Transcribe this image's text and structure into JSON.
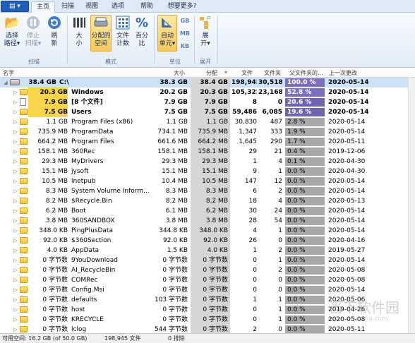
{
  "menu": {
    "app_button": "▤ ▾"
  },
  "tabs": [
    {
      "label": "主页",
      "active": true
    },
    {
      "label": "扫描",
      "active": false
    },
    {
      "label": "视图",
      "active": false
    },
    {
      "label": "选项",
      "active": false
    },
    {
      "label": "帮助",
      "active": false
    },
    {
      "label": "想要更多?",
      "active": false
    }
  ],
  "ribbon": {
    "choose_path": {
      "label1": "选择",
      "label2": "路径▾",
      "icon": "folder-open-icon"
    },
    "stop_scan": {
      "label1": "停止",
      "label2": "扫描▾",
      "icon": "pause-icon"
    },
    "refresh": {
      "label1": "刷",
      "label2": "新",
      "icon": "refresh-icon"
    },
    "group_scan": "扫描",
    "size": {
      "label1": "大",
      "label2": "小",
      "icon": "bars-icon"
    },
    "allocated": {
      "label1": "分配的",
      "label2": "空间",
      "icon": "disk-icon"
    },
    "file_count": {
      "label1": "文件",
      "label2": "计数",
      "icon": "grid-icon"
    },
    "percent": {
      "label1": "百分",
      "label2": "比",
      "icon": "percent-icon"
    },
    "group_mode": "模式",
    "auto_unit": {
      "label1": "自动",
      "label2": "单元▾",
      "icon": "ruler-icon"
    },
    "gb": "GB",
    "mb": "MB",
    "kb": "KB",
    "group_unit": "单位",
    "expand": {
      "label1": "展",
      "label2": "开▾",
      "icon": "expand-icon"
    },
    "group_expand": "展开"
  },
  "columns": {
    "name": "名字",
    "size": "大小",
    "allocated": "分配",
    "files": "文件",
    "folders": "文件夹",
    "parent_pct": "父文件夹的...",
    "last_modified": "上一次更改"
  },
  "rows": [
    {
      "tree_size": "38.4 GB",
      "name": "C:\\",
      "size": "38.3 GB",
      "allocated": "38.4 GB",
      "files": "198,945",
      "folders": "30,518",
      "pct": "100.0 %",
      "pct_value": 100,
      "date": "2020-05-14",
      "bold": true,
      "selected": true,
      "kind": "drive"
    },
    {
      "tree_size": "20.3 GB",
      "name": "Windows",
      "size": "20.2 GB",
      "allocated": "20.3 GB",
      "files": "105,325",
      "folders": "23,168",
      "pct": "52.8 %",
      "pct_value": 52.8,
      "date": "2020-05-14",
      "bold": true,
      "kind": "folder"
    },
    {
      "tree_size": "7.9 GB",
      "name": "[8 个文件]",
      "size": "7.9 GB",
      "allocated": "7.9 GB",
      "files": "8",
      "folders": "0",
      "pct": "20.6 %",
      "pct_value": 20.6,
      "date": "2020-05-14",
      "bold": true,
      "kind": "file"
    },
    {
      "tree_size": "7.5 GB",
      "name": "Users",
      "size": "7.5 GB",
      "allocated": "7.5 GB",
      "files": "59,486",
      "folders": "6,085",
      "pct": "19.6 %",
      "pct_value": 19.6,
      "date": "2020-05-14",
      "bold": true,
      "kind": "folder"
    },
    {
      "tree_size": "1.1 GB",
      "name": "Program Files (x86)",
      "size": "1.1 GB",
      "allocated": "1.1 GB",
      "files": "30,830",
      "folders": "487",
      "pct": "2.8 %",
      "pct_value": 2.8,
      "date": "2020-05-14",
      "kind": "folder"
    },
    {
      "tree_size": "735.9 MB",
      "name": "ProgramData",
      "size": "734.1 MB",
      "allocated": "735.9 MB",
      "files": "1,347",
      "folders": "333",
      "pct": "1.9 %",
      "pct_value": 1.9,
      "date": "2020-05-14",
      "kind": "folder"
    },
    {
      "tree_size": "664.2 MB",
      "name": "Program Files",
      "size": "661.6 MB",
      "allocated": "664.2 MB",
      "files": "1,645",
      "folders": "290",
      "pct": "1.7 %",
      "pct_value": 1.7,
      "date": "2020-05-11",
      "kind": "folder"
    },
    {
      "tree_size": "158.1 MB",
      "name": "360Rec",
      "size": "158.1 MB",
      "allocated": "158.1 MB",
      "files": "29",
      "folders": "21",
      "pct": "0.4 %",
      "pct_value": 0.4,
      "date": "2019-12-06",
      "kind": "folder"
    },
    {
      "tree_size": "29.3 MB",
      "name": "MyDrivers",
      "size": "29.3 MB",
      "allocated": "29.3 MB",
      "files": "1",
      "folders": "4",
      "pct": "0.1 %",
      "pct_value": 0.1,
      "date": "2020-04-30",
      "kind": "folder"
    },
    {
      "tree_size": "15.1 MB",
      "name": "jysoft",
      "size": "15.1 MB",
      "allocated": "15.1 MB",
      "files": "9",
      "folders": "1",
      "pct": "0.0 %",
      "pct_value": 0,
      "date": "2020-04-30",
      "kind": "folder"
    },
    {
      "tree_size": "10.5 MB",
      "name": "inetpub",
      "size": "10.4 MB",
      "allocated": "10.5 MB",
      "files": "147",
      "folders": "12",
      "pct": "0.0 %",
      "pct_value": 0,
      "date": "2020-05-14",
      "kind": "folder"
    },
    {
      "tree_size": "8.3 MB",
      "name": "System Volume Inform...",
      "size": "8.3 MB",
      "allocated": "8.3 MB",
      "files": "6",
      "folders": "2",
      "pct": "0.0 %",
      "pct_value": 0,
      "date": "2020-05-14",
      "kind": "folder"
    },
    {
      "tree_size": "8.2 MB",
      "name": "$Recycle.Bin",
      "size": "8.2 MB",
      "allocated": "8.2 MB",
      "files": "18",
      "folders": "4",
      "pct": "0.0 %",
      "pct_value": 0,
      "date": "2020-05-13",
      "kind": "folder"
    },
    {
      "tree_size": "6.2 MB",
      "name": "Boot",
      "size": "6.1 MB",
      "allocated": "6.2 MB",
      "files": "30",
      "folders": "24",
      "pct": "0.0 %",
      "pct_value": 0,
      "date": "2020-05-14",
      "kind": "folder"
    },
    {
      "tree_size": "3.8 MB",
      "name": "360SANDBOX",
      "size": "3.8 MB",
      "allocated": "3.8 MB",
      "files": "28",
      "folders": "54",
      "pct": "0.0 %",
      "pct_value": 0,
      "date": "2020-05-14",
      "kind": "folder"
    },
    {
      "tree_size": "348.0 KB",
      "name": "PingPlusData",
      "size": "344.8 KB",
      "allocated": "348.0 KB",
      "files": "4",
      "folders": "1",
      "pct": "0.0 %",
      "pct_value": 0,
      "date": "2020-05-14",
      "kind": "folder"
    },
    {
      "tree_size": "92.0 KB",
      "name": "$360Section",
      "size": "92.0 KB",
      "allocated": "92.0 KB",
      "files": "26",
      "folders": "0",
      "pct": "0.0 %",
      "pct_value": 0,
      "date": "2020-04-16",
      "kind": "folder"
    },
    {
      "tree_size": "4.0 KB",
      "name": "AppData",
      "size": "1.5 KB",
      "allocated": "4.0 KB",
      "files": "1",
      "folders": "2",
      "pct": "0.0 %",
      "pct_value": 0,
      "date": "2019-05-27",
      "kind": "folder"
    },
    {
      "tree_size": "0 字节数",
      "name": "9YouDownload",
      "size": "0 字节数",
      "allocated": "0 字节数",
      "files": "0",
      "folders": "1",
      "pct": "0.0 %",
      "pct_value": 0,
      "date": "2020-05-14",
      "kind": "folder"
    },
    {
      "tree_size": "0 字节数",
      "name": "AI_RecycleBin",
      "size": "0 字节数",
      "allocated": "0 字节数",
      "files": "0",
      "folders": "2",
      "pct": "0.0 %",
      "pct_value": 0,
      "date": "2020-05-08",
      "kind": "folder"
    },
    {
      "tree_size": "0 字节数",
      "name": "COMRec",
      "size": "0 字节数",
      "allocated": "0 字节数",
      "files": "0",
      "folders": "0",
      "pct": "0.0 %",
      "pct_value": 0,
      "date": "2020-05-08",
      "kind": "folder"
    },
    {
      "tree_size": "0 字节数",
      "name": "Config.Msi",
      "size": "0 字节数",
      "allocated": "0 字节数",
      "files": "0",
      "folders": "0",
      "pct": "0.0 %",
      "pct_value": 0,
      "date": "2020-05-14",
      "kind": "folder"
    },
    {
      "tree_size": "0 字节数",
      "name": "defaults",
      "size": "103 字节数",
      "allocated": "0 字节数",
      "files": "1",
      "folders": "1",
      "pct": "0.0 %",
      "pct_value": 0,
      "date": "2020-05-06",
      "kind": "folder"
    },
    {
      "tree_size": "0 字节数",
      "name": "host",
      "size": "0 字节数",
      "allocated": "0 字节数",
      "files": "0",
      "folders": "1",
      "pct": "0.0 %",
      "pct_value": 0,
      "date": "2019-04-26",
      "kind": "folder"
    },
    {
      "tree_size": "0 字节数",
      "name": "KRECYCLE",
      "size": "0 字节数",
      "allocated": "0 字节数",
      "files": "0",
      "folders": "1",
      "pct": "0.0 %",
      "pct_value": 0,
      "date": "2020-05-08",
      "kind": "folder"
    },
    {
      "tree_size": "0 字节数",
      "name": "lclog",
      "size": "544 字节数",
      "allocated": "0 字节数",
      "files": "2",
      "folders": "0",
      "pct": "0.0 %",
      "pct_value": 0,
      "date": "2020-05-11",
      "kind": "folder"
    }
  ],
  "status": {
    "free_space": "可用空间: 16.2 GB  (of 50.0 GB)",
    "file_count": "198,945 文件",
    "excluded": "0 排除"
  },
  "watermark": {
    "text": "当下软件园",
    "url": "www.downxia.com"
  },
  "colors": {
    "selection": "#cde2f8",
    "ribbon_active": "#f7c95a",
    "bar_highlight": "#7b6fbf"
  }
}
